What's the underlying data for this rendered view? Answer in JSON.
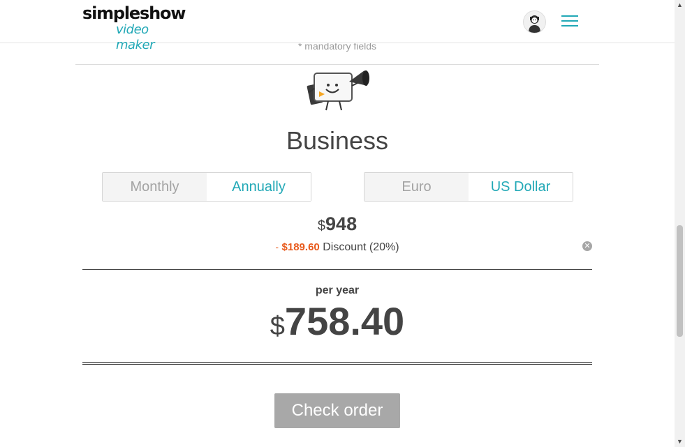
{
  "header": {
    "logo_line1": "simpleshow",
    "logo_line2": "video maker",
    "menu_icon": "hamburger-menu-icon",
    "avatar_icon": "user-avatar-icon",
    "accent_color": "#21a8b6"
  },
  "form": {
    "mandatory_note": "* mandatory fields"
  },
  "plan": {
    "mascot_icon": "megaphone-mascot-icon",
    "title": "Business",
    "billing_options": [
      "Monthly",
      "Annually"
    ],
    "billing_selected": "Annually",
    "currency_options": [
      "Euro",
      "US Dollar"
    ],
    "currency_selected": "US Dollar",
    "currency_symbol": "$",
    "base_price": "948",
    "discount_minus": "-",
    "discount_amount": "$189.60",
    "discount_label": "Discount (20%)",
    "discount_color": "#e85a1c",
    "period_label": "per year",
    "total_price": "758.40",
    "remove_icon": "close-circle-icon"
  },
  "actions": {
    "check_order": "Check order"
  }
}
